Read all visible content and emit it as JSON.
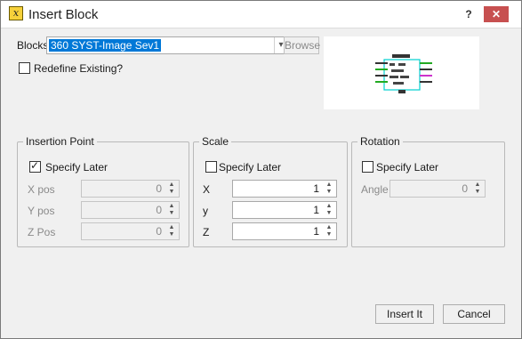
{
  "window": {
    "title": "Insert Block",
    "help": "?",
    "close": "✕"
  },
  "blocks": {
    "label": "Blocks",
    "value": "360 SYST-Image Sev1",
    "dropdown_icon": "chevron-down-icon",
    "browse_label": "Browse"
  },
  "redefine": {
    "label": "Redefine Existing?",
    "checked": false
  },
  "insertion_point": {
    "title": "Insertion Point",
    "specify_later": {
      "label": "Specify Later",
      "checked": true
    },
    "fields": [
      {
        "label": "X pos",
        "value": "0"
      },
      {
        "label": "Y pos",
        "value": "0"
      },
      {
        "label": "Z Pos",
        "value": "0"
      }
    ]
  },
  "scale": {
    "title": "Scale",
    "specify_later": {
      "label": "Specify Later",
      "checked": false
    },
    "fields": [
      {
        "label": "X",
        "value": "1"
      },
      {
        "label": "y",
        "value": "1"
      },
      {
        "label": "Z",
        "value": "1"
      }
    ]
  },
  "rotation": {
    "title": "Rotation",
    "specify_later": {
      "label": "Specify Later",
      "checked": false
    },
    "angle": {
      "label": "Angle",
      "value": "0"
    }
  },
  "buttons": {
    "insert": "Insert It",
    "cancel": "Cancel"
  },
  "spin_arrows": {
    "up": "▲",
    "down": "▼"
  }
}
